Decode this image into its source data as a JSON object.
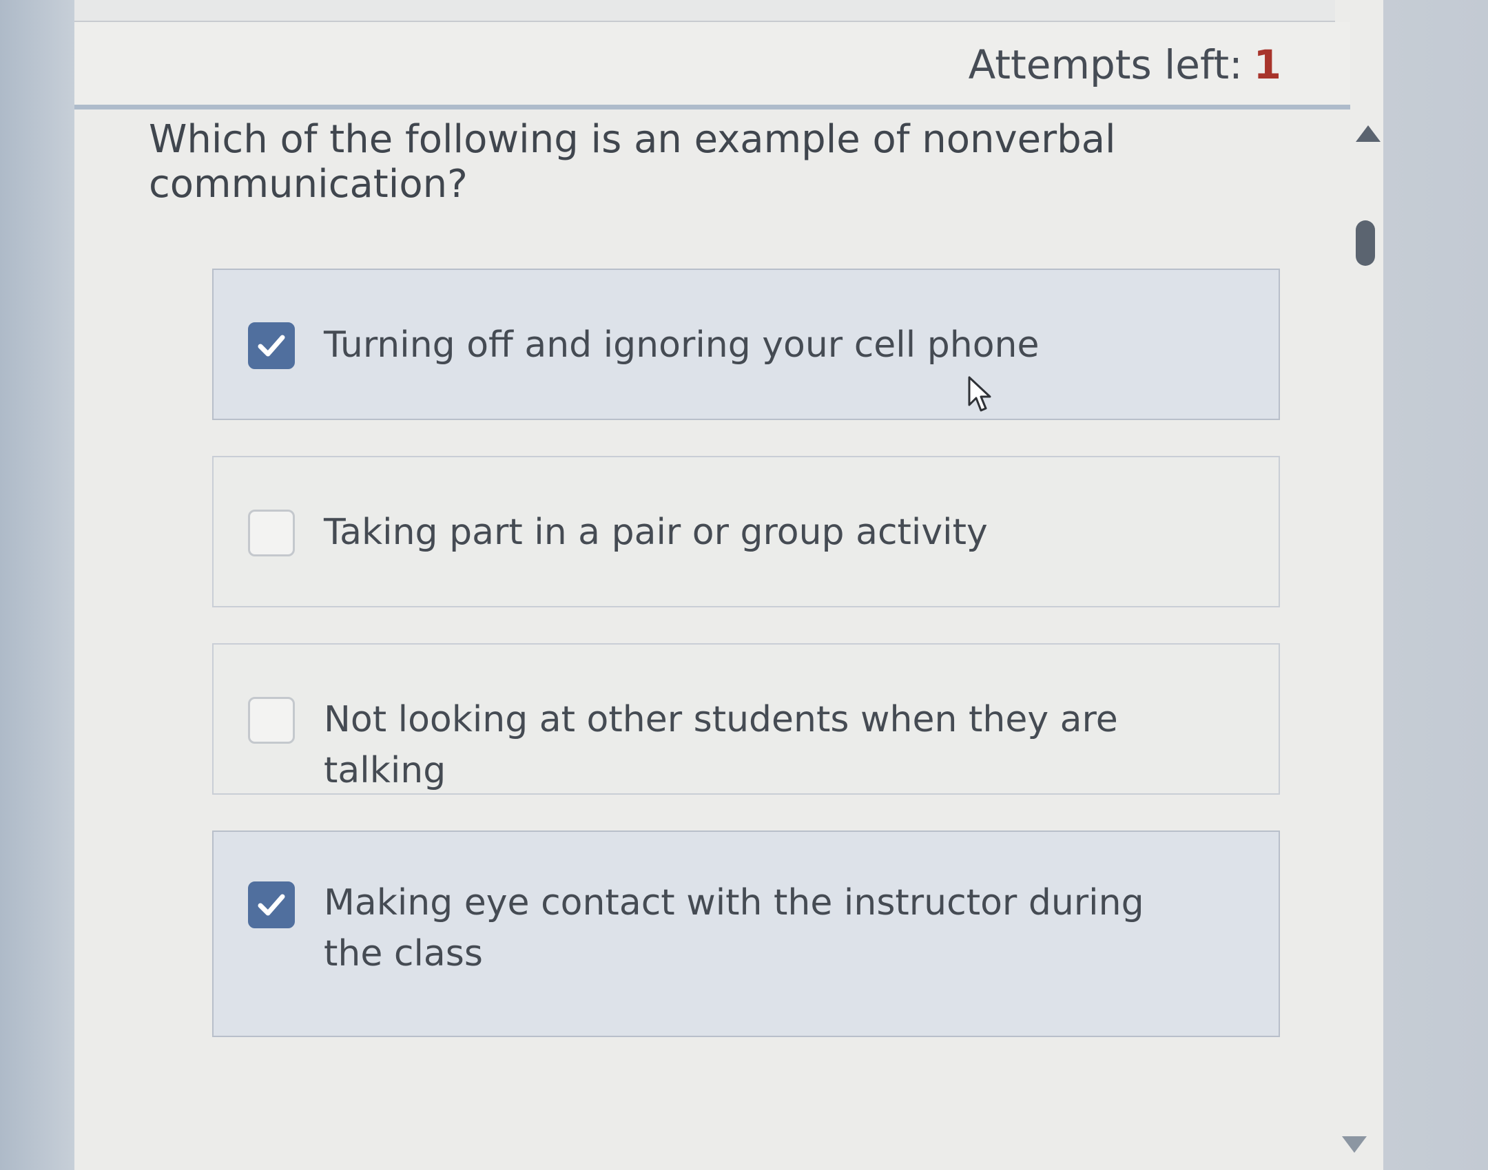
{
  "header": {
    "attempts_label": "Attempts left:",
    "attempts_value": "1"
  },
  "question": {
    "text": "Which of the following is an example of nonverbal communication?"
  },
  "options": [
    {
      "label": "Turning off and ignoring your cell phone",
      "checked": true
    },
    {
      "label": "Taking part in a pair or group activity",
      "checked": false
    },
    {
      "label": "Not looking at other students when they are talking",
      "checked": false
    },
    {
      "label": "Making eye contact with the instructor during the class",
      "checked": true
    }
  ],
  "icons": {
    "checkmark": "check-icon",
    "cursor": "mouse-pointer-icon",
    "scroll_up": "scroll-up-arrow-icon",
    "scroll_down": "scroll-down-arrow-icon"
  },
  "colors": {
    "checked_box": "#506f9e",
    "attempts_value": "#a8342b",
    "text": "#454b53"
  }
}
